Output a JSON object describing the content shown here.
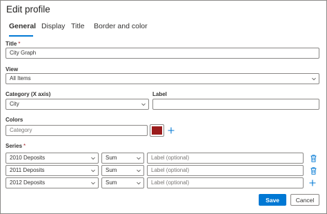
{
  "dialog": {
    "title": "Edit profile"
  },
  "tabs": [
    {
      "label": "General",
      "active": true
    },
    {
      "label": "Display",
      "active": false
    },
    {
      "label": "Title",
      "active": false
    },
    {
      "label": "Border and color",
      "active": false
    }
  ],
  "form": {
    "title": {
      "label": "Title",
      "required_mark": "*",
      "value": "City Graph"
    },
    "view": {
      "label": "View",
      "value": "All Items"
    },
    "category": {
      "label": "Category (X axis)",
      "value": "City"
    },
    "label_field": {
      "label": "Label",
      "value": ""
    },
    "colors": {
      "label": "Colors",
      "placeholder": "Category",
      "swatch_color": "#9b1c1c"
    },
    "series": {
      "label": "Series",
      "required_mark": "*",
      "rows": [
        {
          "field": "2010 Deposits",
          "aggregate": "Sum",
          "label_placeholder": "Label (optional)"
        },
        {
          "field": "2011 Deposits",
          "aggregate": "Sum",
          "label_placeholder": "Label (optional)"
        },
        {
          "field": "2012 Deposits",
          "aggregate": "Sum",
          "label_placeholder": "Label (optional)"
        }
      ]
    }
  },
  "buttons": {
    "save": "Save",
    "cancel": "Cancel"
  },
  "colors": {
    "accent": "#0078d4",
    "required": "#a4262c",
    "delete_icon": "#0078d4"
  },
  "icons": {
    "dropdown": "chevron-down-icon",
    "add": "plus-icon",
    "delete": "trash-icon"
  }
}
